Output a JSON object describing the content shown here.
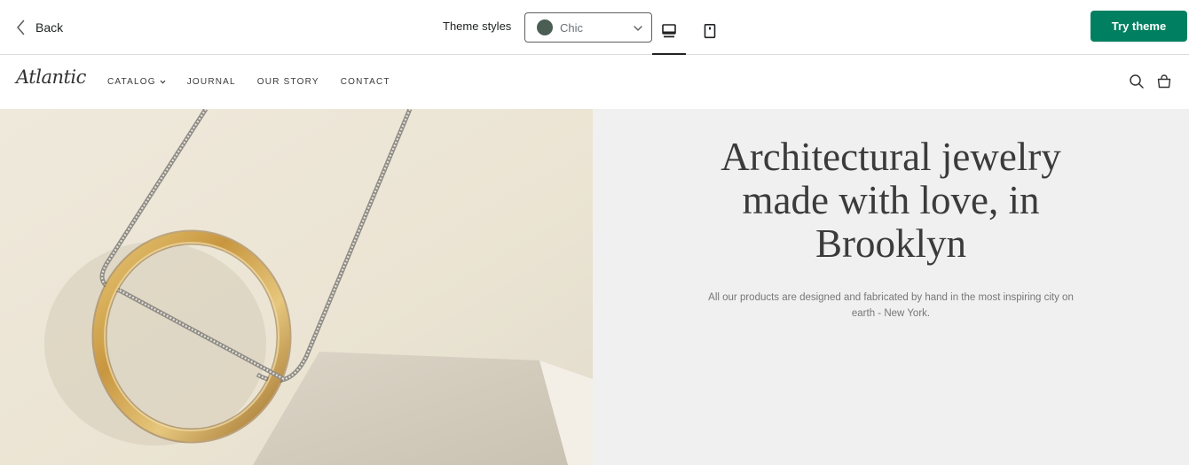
{
  "topbar": {
    "back_label": "Back",
    "styles_label": "Theme styles",
    "selected_style": "Chic",
    "selected_style_color": "#4a5e54",
    "active_device": "desktop",
    "devices": [
      "desktop-icon",
      "tablet-icon"
    ],
    "try_theme_label": "Try theme",
    "accent_color": "#008060"
  },
  "store": {
    "logo": "Atlantic",
    "nav": [
      {
        "label": "CATALOG",
        "has_dropdown": true
      },
      {
        "label": "JOURNAL",
        "has_dropdown": false
      },
      {
        "label": "OUR STORY",
        "has_dropdown": false
      },
      {
        "label": "CONTACT",
        "has_dropdown": false
      }
    ],
    "header_icons": [
      "search-icon",
      "shopping-bag-icon"
    ]
  },
  "hero": {
    "heading": "Architectural jewelry made with love, in Brooklyn",
    "subtext": "All our products are designed and fabricated by hand in the most inspiring city on earth - New York.",
    "image": "gold-ring-pendant-on-silver-chain"
  }
}
